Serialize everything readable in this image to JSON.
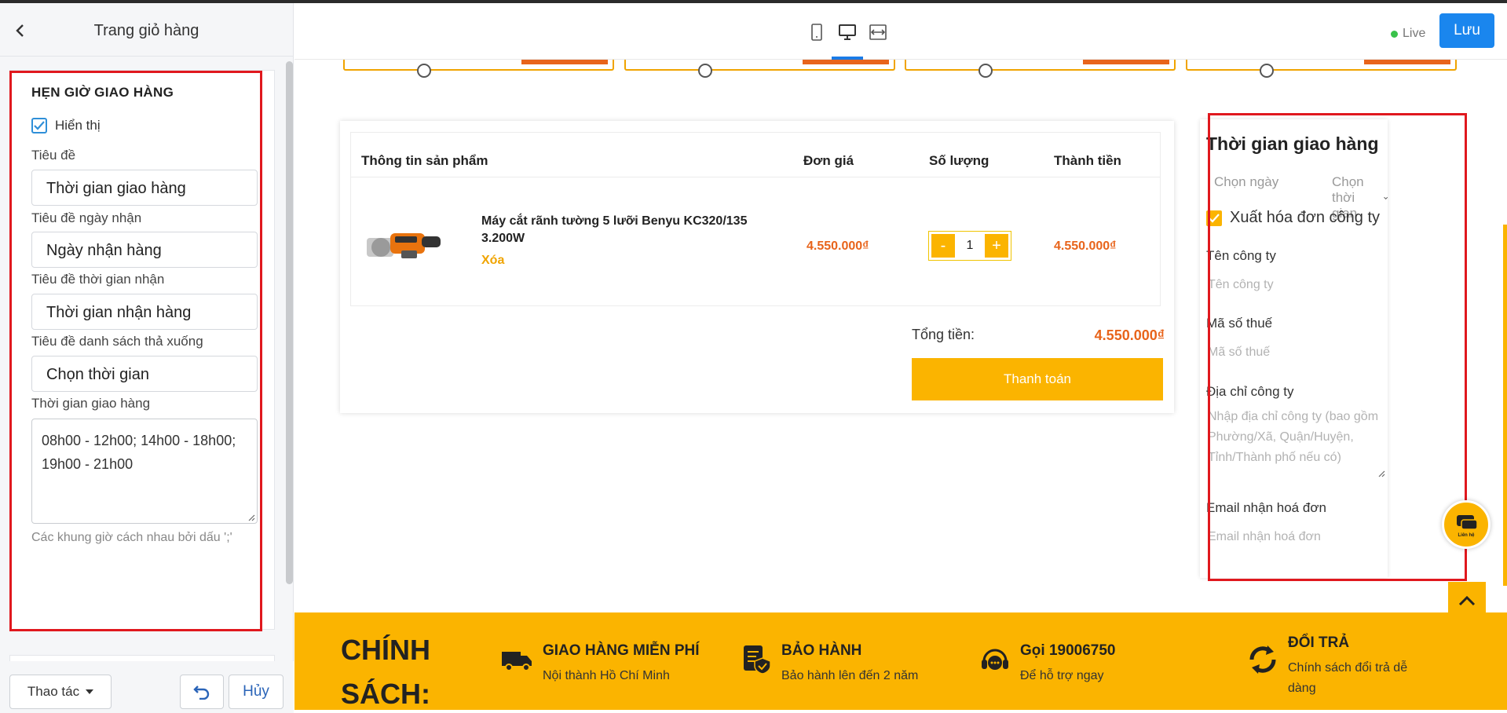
{
  "left_panel": {
    "title": "Trang giỏ hàng",
    "section": {
      "title": "HẸN GIỜ GIAO HÀNG",
      "show_label": "Hiển thị",
      "show_checked": true,
      "fields": [
        {
          "label": "Tiêu đề",
          "value": "Thời gian giao hàng"
        },
        {
          "label": "Tiêu đề ngày nhận",
          "value": "Ngày nhận hàng"
        },
        {
          "label": "Tiêu đề thời gian nhận",
          "value": "Thời gian nhận hàng"
        },
        {
          "label": "Tiêu đề danh sách thả xuống",
          "value": "Chọn thời gian"
        }
      ],
      "textarea_label": "Thời gian giao hàng",
      "textarea_value": "08h00 - 12h00; 14h00 - 18h00; 19h00 - 21h00",
      "hint": "Các khung giờ cách nhau bởi dấu ';'"
    },
    "footer": {
      "actions_label": "Thao tác",
      "cancel_label": "Hủy"
    }
  },
  "topbar": {
    "devices": [
      "mobile-icon",
      "desktop-icon",
      "fullwidth-icon"
    ],
    "active_device": "desktop-icon",
    "live_label": "Live",
    "save_label": "Lưu"
  },
  "cart": {
    "headers": {
      "product": "Thông tin sản phẩm",
      "unit_price": "Đơn giá",
      "quantity": "Số lượng",
      "subtotal": "Thành tiền"
    },
    "items": [
      {
        "name": "Máy cắt rãnh tường 5 lưỡi Benyu KC320/135 3.200W",
        "remove": "Xóa",
        "price": "4.550.000₫",
        "qty": "1",
        "subtotal": "4.550.000₫"
      }
    ],
    "total_label": "Tổng tiền:",
    "total_value": "4.550.000₫",
    "checkout_label": "Thanh toán",
    "qty_minus": "-",
    "qty_plus": "+"
  },
  "delivery": {
    "title": "Thời gian giao hàng",
    "date_placeholder": "Chọn ngày",
    "time_placeholder": "Chọn thời gian",
    "invoice_label": "Xuất hóa đơn công ty",
    "invoice_checked": true,
    "company_label": "Tên công ty",
    "company_placeholder": "Tên công ty",
    "tax_label": "Mã số thuế",
    "tax_placeholder": "Mã số thuế",
    "address_label": "Địa chỉ công ty",
    "address_placeholder": "Nhập địa chỉ công ty (bao gồm Phường/Xã, Quận/Huyện, Tỉnh/Thành phố nếu có)",
    "email_label": "Email nhận hoá đơn",
    "email_placeholder": "Email nhận hoá đơn"
  },
  "policy": {
    "title": "CHÍNH SÁCH:",
    "items": [
      {
        "icon": "truck-icon",
        "title": "GIAO HÀNG MIỄN PHÍ",
        "desc": "Nội thành Hồ Chí Minh"
      },
      {
        "icon": "warranty-icon",
        "title": "BẢO HÀNH",
        "desc": "Bảo hành lên đến 2 năm"
      },
      {
        "icon": "headset-icon",
        "title": "Gọi 19006750",
        "desc": "Để hỗ trợ ngay"
      },
      {
        "icon": "return-icon",
        "title": "ĐỔI TRẢ",
        "desc": "Chính sách đổi trả dễ dàng"
      }
    ]
  },
  "chat_bubble_label": "Liên hệ",
  "colors": {
    "accent": "#fbb400",
    "price": "#e8641b",
    "primary": "#1a86ee",
    "highlight": "#e0181e"
  }
}
